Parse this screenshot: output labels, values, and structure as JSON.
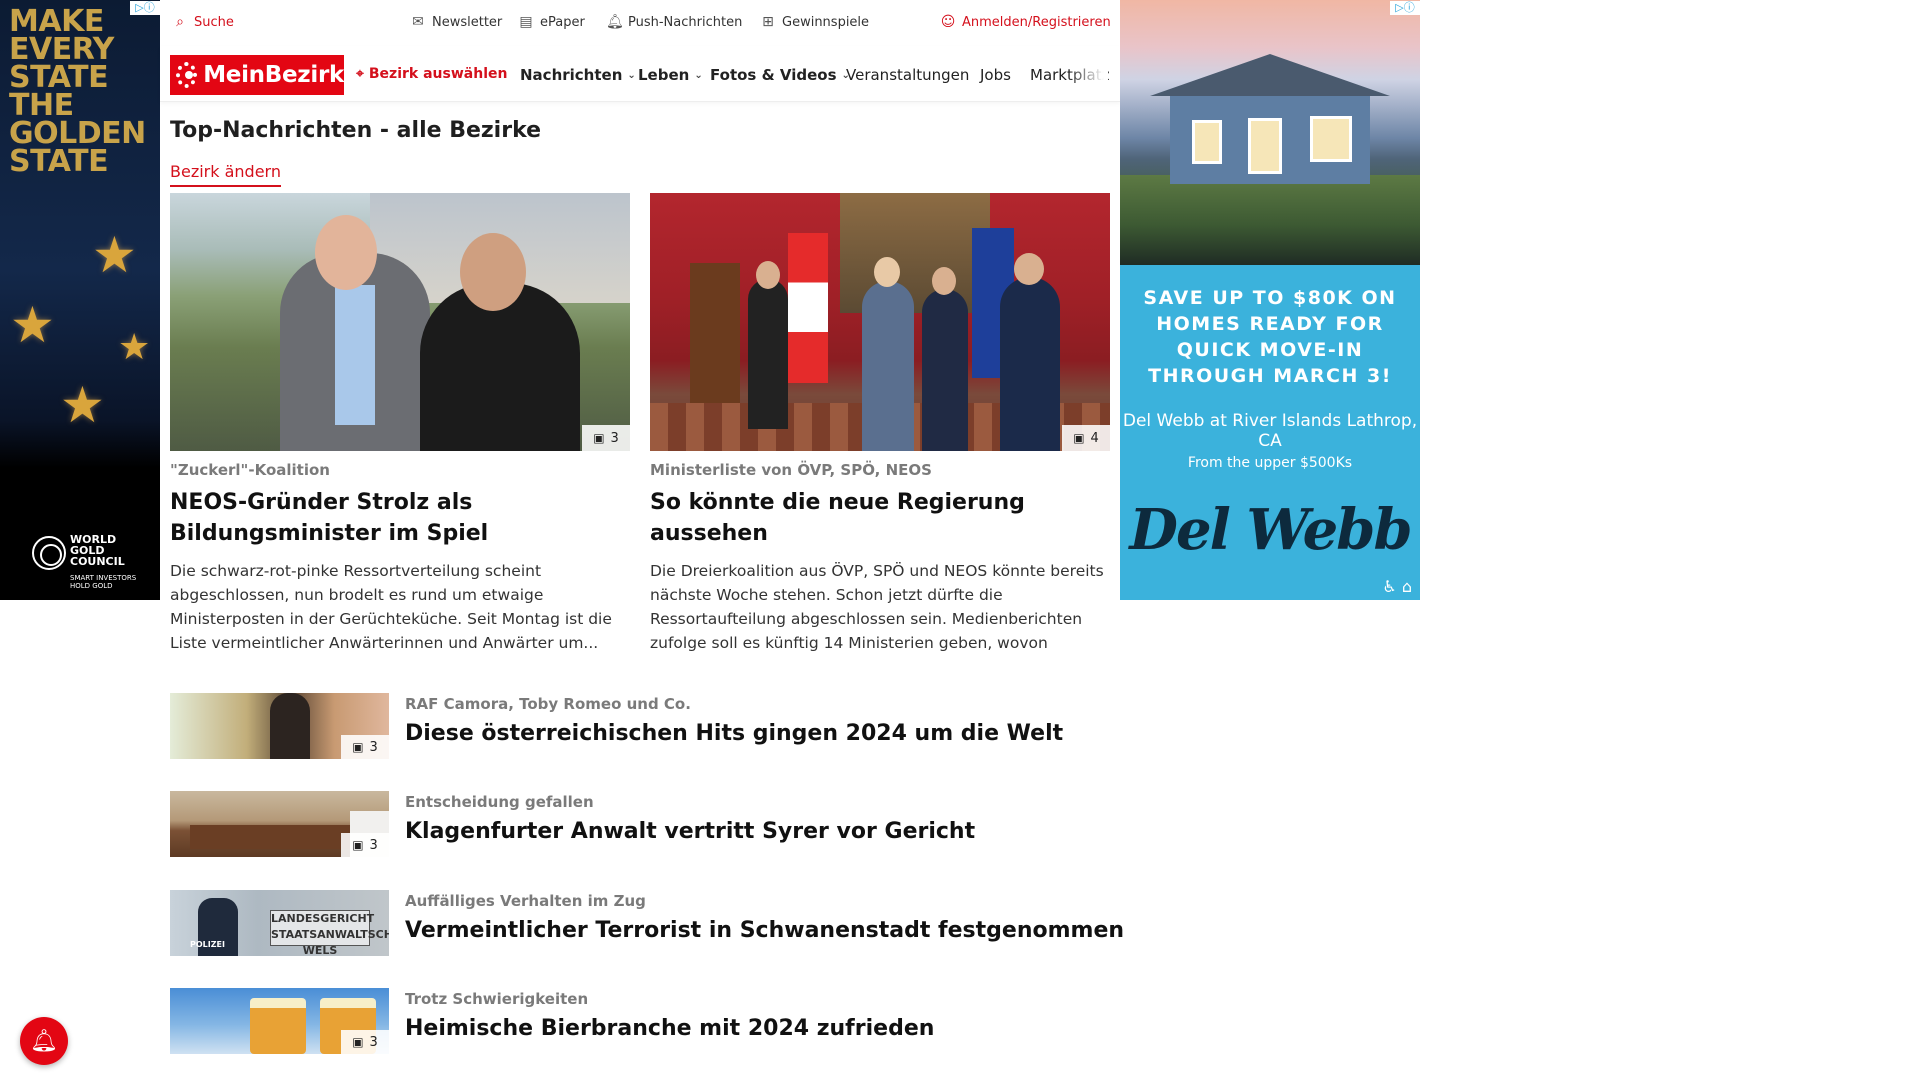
{
  "ads": {
    "left": {
      "headline": "MAKE EVERY STATE THE GOLDEN STATE",
      "brand": "WORLD GOLD COUNCIL",
      "tagline": "SMART INVESTORS HOLD GOLD"
    },
    "right": {
      "headline": "SAVE UP TO $80K ON HOMES READY FOR QUICK MOVE-IN THROUGH MARCH 3!",
      "location": "Del Webb at River Islands Lathrop, CA",
      "price": "From the upper $500Ks",
      "brand": "Del Webb"
    }
  },
  "utility": {
    "search": "Suche",
    "newsletter": "Newsletter",
    "epaper": "ePaper",
    "push": "Push-Nachrichten",
    "contests": "Gewinnspiele",
    "login": "Anmelden/Registrieren"
  },
  "nav": {
    "logo": "MeinBezirk",
    "district": "Bezirk auswählen",
    "items": [
      {
        "label": "Nachrichten",
        "dropdown": true
      },
      {
        "label": "Leben",
        "dropdown": true
      },
      {
        "label": "Fotos & Videos",
        "dropdown": true
      },
      {
        "label": "Veranstaltungen",
        "dropdown": false
      },
      {
        "label": "Jobs",
        "dropdown": false
      },
      {
        "label": "Marktplatz",
        "dropdown": false
      }
    ]
  },
  "section": {
    "title": "Top-Nachrichten - alle Bezirke",
    "change_district": "Bezirk ändern"
  },
  "top_articles": [
    {
      "kicker": "\"Zuckerl\"-Koalition",
      "title": "NEOS-Gründer Strolz als Bildungsminister im Spiel",
      "teaser": "Die schwarz-rot-pinke Ressortverteilung scheint abgeschlossen, nun brodelt es rund um etwaige Ministerposten in der Gerüchteküche. Seit Montag ist die Liste vermeintlicher Anwärterinnen und Anwärter um...",
      "image_count": "3"
    },
    {
      "kicker": "Ministerliste von ÖVP, SPÖ, NEOS",
      "title": "So könnte die neue Regierung aussehen",
      "teaser": "Die Dreierkoalition aus ÖVP, SPÖ und NEOS könnte bereits nächste Woche stehen. Schon jetzt dürfte die Ressortaufteilung abgeschlossen sein. Medienberichten zufolge soll es künftig 14 Ministerien geben, wovon jeweil...",
      "image_count": "4"
    }
  ],
  "list_articles": [
    {
      "kicker": "RAF Camora, Toby Romeo und Co.",
      "title": "Diese österreichischen Hits gingen 2024 um die Welt",
      "image_count": "3"
    },
    {
      "kicker": "Entscheidung gefallen",
      "title": "Klagenfurter Anwalt vertritt Syrer vor Gericht",
      "image_count": "3"
    },
    {
      "kicker": "Auffälliges Verhalten im Zug",
      "title": "Vermeintlicher Terrorist in Schwanenstadt festgenommen",
      "image_count": ""
    },
    {
      "kicker": "Trotz Schwierigkeiten",
      "title": "Heimische Bierbranche mit 2024 zufrieden",
      "image_count": "3"
    }
  ],
  "thumb_text": {
    "court_sign": "LANDESGERICHT STAATSANWALTSCHAFT WELS",
    "police": "POLIZEI"
  },
  "icons": {
    "search": "search-icon",
    "newsletter": "mail-icon",
    "epaper": "newspaper-icon",
    "push": "bell-icon",
    "contests": "gift-icon",
    "login": "user-icon",
    "district": "location-pin-icon",
    "camera": "gallery-icon",
    "notification": "bell-icon"
  },
  "colors": {
    "brand_red": "#e30613",
    "link_red": "#d4101c",
    "kicker_gray": "#7a7a7a",
    "ad_blue": "#3bb2dc"
  }
}
